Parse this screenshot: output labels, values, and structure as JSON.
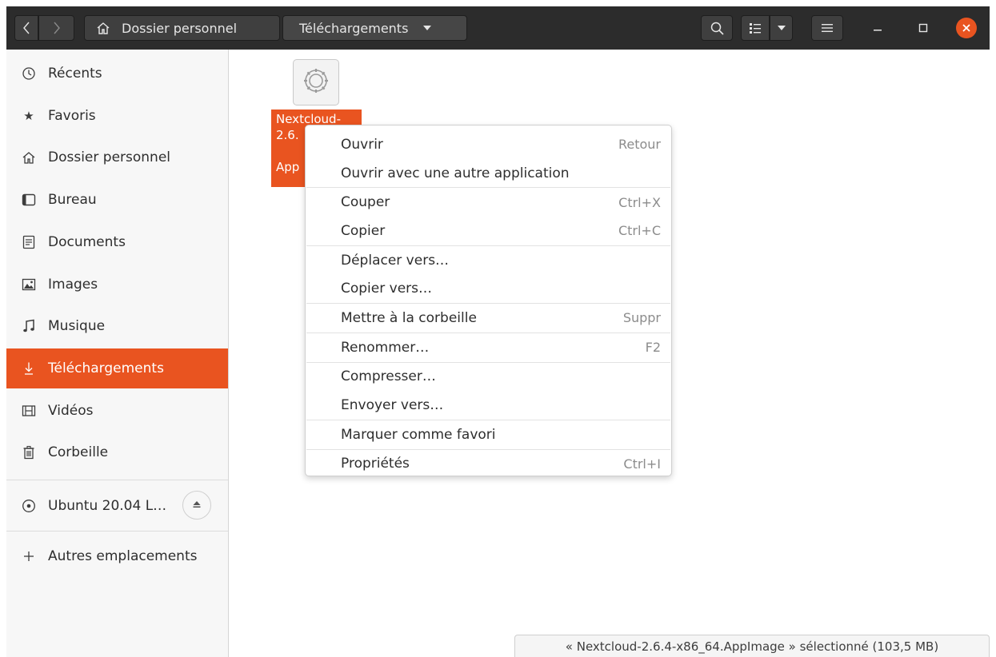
{
  "header": {
    "back_icon": "chevron-left-icon",
    "forward_icon": "chevron-right-icon",
    "home_crumb": "Dossier personnel",
    "current_crumb": "Téléchargements",
    "search_icon": "search-icon",
    "view_icon": "list-view-icon",
    "menu_icon": "hamburger-menu-icon"
  },
  "sidebar": {
    "items": [
      {
        "label": "Récents",
        "icon": "clock-icon"
      },
      {
        "label": "Favoris",
        "icon": "star-icon"
      },
      {
        "label": "Dossier personnel",
        "icon": "home-icon"
      },
      {
        "label": "Bureau",
        "icon": "desktop-icon"
      },
      {
        "label": "Documents",
        "icon": "document-icon"
      },
      {
        "label": "Images",
        "icon": "image-icon"
      },
      {
        "label": "Musique",
        "icon": "music-icon"
      },
      {
        "label": "Téléchargements",
        "icon": "download-icon",
        "active": true
      },
      {
        "label": "Vidéos",
        "icon": "film-icon"
      },
      {
        "label": "Corbeille",
        "icon": "trash-icon"
      }
    ],
    "drive": {
      "label": "Ubuntu 20.04 L…",
      "icon": "disc-icon",
      "eject_icon": "eject-icon"
    },
    "other": {
      "label": "Autres emplacements",
      "icon": "plus-icon"
    }
  },
  "file": {
    "name_lines": [
      "Nextcloud-",
      "2.6.",
      "",
      "App"
    ],
    "icon": "gear-icon"
  },
  "context_menu": {
    "items": [
      {
        "label": "Ouvrir",
        "accel": "Retour"
      },
      {
        "label": "Ouvrir avec une autre application",
        "accel": ""
      },
      {
        "label": "Couper",
        "accel": "Ctrl+X"
      },
      {
        "label": "Copier",
        "accel": "Ctrl+C"
      },
      {
        "label": "Déplacer vers…",
        "accel": ""
      },
      {
        "label": "Copier vers…",
        "accel": ""
      },
      {
        "label": "Mettre à la corbeille",
        "accel": "Suppr"
      },
      {
        "label": "Renommer…",
        "accel": "F2"
      },
      {
        "label": "Compresser…",
        "accel": ""
      },
      {
        "label": "Envoyer vers…",
        "accel": ""
      },
      {
        "label": "Marquer comme favori",
        "accel": ""
      },
      {
        "label": "Propriétés",
        "accel": "Ctrl+I"
      }
    ]
  },
  "status": {
    "text": "« Nextcloud-2.6.4-x86_64.AppImage » sélectionné (103,5 MB)"
  },
  "colors": {
    "accent": "#e95420",
    "headerbar": "#2c2c2c",
    "sidebar_bg": "#f7f7f7"
  }
}
